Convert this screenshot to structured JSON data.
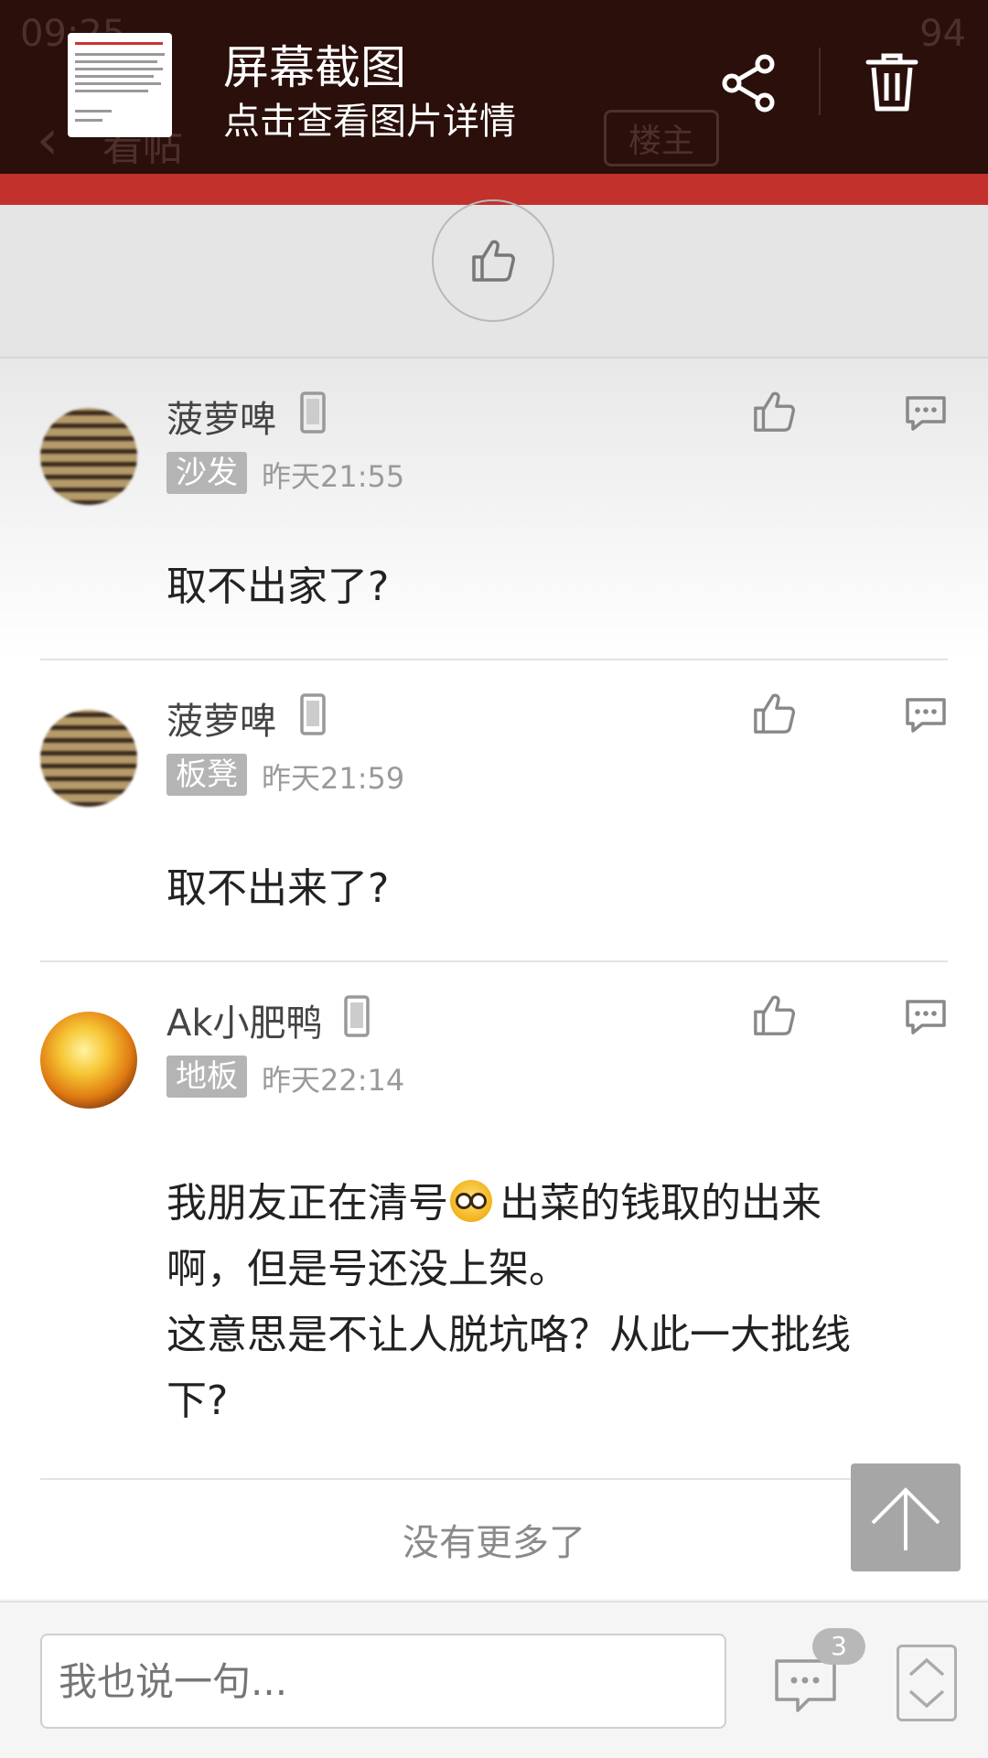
{
  "screenshot_notification": {
    "title": "屏幕截图",
    "subtitle": "点击查看图片详情"
  },
  "underlying_header": {
    "status_time": "09:25",
    "battery_level": "94",
    "page_title": "看帖",
    "owner_button": "楼主"
  },
  "comments": [
    {
      "username": "菠萝啤",
      "floor": "沙发",
      "time": "昨天21:55",
      "text": "取不出家了?"
    },
    {
      "username": "菠萝啤",
      "floor": "板凳",
      "time": "昨天21:59",
      "text": "取不出来了?"
    },
    {
      "username": "Ak小肥鸭",
      "floor": "地板",
      "time": "昨天22:14",
      "text_part1": "我朋友正在清号",
      "text_part2": "出菜的钱取的出来\n啊，但是号还没上架。\n这意思是不让人脱坑咯？从此一大批线\n下?"
    }
  ],
  "footer": {
    "no_more": "没有更多了"
  },
  "bottom_bar": {
    "reply_placeholder": "我也说一句...",
    "message_count": "3"
  },
  "colors": {
    "notification_bg": "#2a0f0b",
    "red_band": "#c2312c",
    "badge_gray": "#b4b4b4"
  }
}
